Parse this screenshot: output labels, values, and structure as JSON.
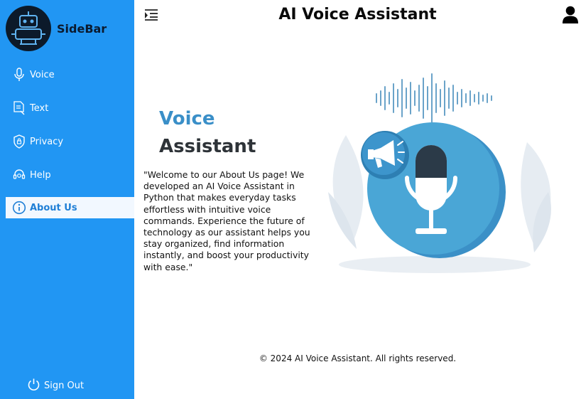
{
  "sidebar": {
    "brand": "SideBar",
    "logo_icon": "robot-icon",
    "items": [
      {
        "label": "Voice",
        "icon": "microphone-icon"
      },
      {
        "label": "Text",
        "icon": "document-icon"
      },
      {
        "label": "Privacy",
        "icon": "shield-icon"
      },
      {
        "label": "Help",
        "icon": "help-icon"
      },
      {
        "label": "About Us",
        "icon": "info-icon",
        "active": true
      }
    ],
    "signout": {
      "label": "Sign Out",
      "icon": "power-icon"
    }
  },
  "header": {
    "title": "AI Voice Assistant",
    "menu_icon": "menu-toggle-icon",
    "user_icon": "user-icon"
  },
  "main": {
    "heading_line1": "Voice",
    "heading_line2": "Assistant",
    "about_text": "\"Welcome to our About Us page! We developed an AI Voice Assistant in Python that makes everyday tasks effortless with intuitive voice commands. Experience the future of technology as our assistant helps you stay organized, find information instantly, and boost your productivity with ease.\"",
    "illustration": "voice-assistant-illustration"
  },
  "footer": {
    "text": "© 2024 AI Voice Assistant. All rights reserved."
  },
  "colors": {
    "sidebar": "#2196f3",
    "active_item_bg": "#f2f8ff",
    "heading_blue": "#3a8fc8",
    "heading_dark": "#2e3338"
  }
}
